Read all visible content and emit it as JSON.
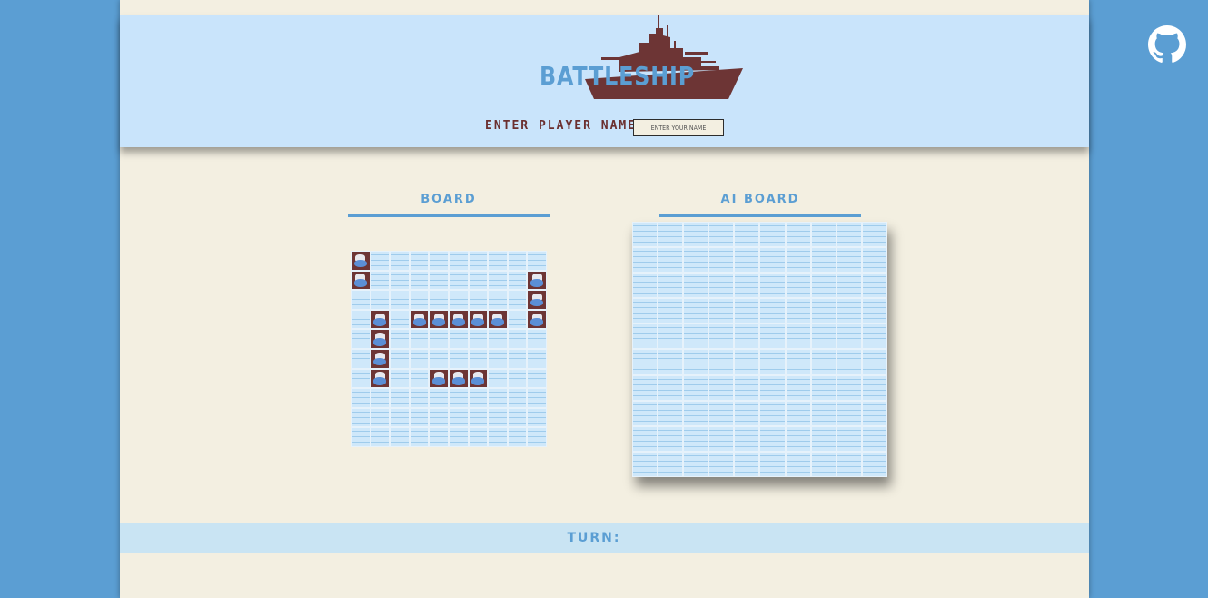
{
  "header": {
    "title": "BATTLESHIP",
    "name_label": "ENTER PLAYER NAME:",
    "name_placeholder": "ENTER YOUR NAME",
    "name_value": ""
  },
  "player_board": {
    "title": "BOARD",
    "rows": 10,
    "cols": 10,
    "ship_cells": [
      [
        0,
        0
      ],
      [
        1,
        0
      ],
      [
        1,
        9
      ],
      [
        2,
        9
      ],
      [
        3,
        9
      ],
      [
        3,
        1
      ],
      [
        4,
        1
      ],
      [
        5,
        1
      ],
      [
        6,
        1
      ],
      [
        3,
        3
      ],
      [
        3,
        4
      ],
      [
        3,
        5
      ],
      [
        3,
        6
      ],
      [
        3,
        7
      ],
      [
        6,
        4
      ],
      [
        6,
        5
      ],
      [
        6,
        6
      ]
    ]
  },
  "ai_board": {
    "title": "AI BOARD",
    "rows": 10,
    "cols": 10
  },
  "turn": {
    "label": "TURN:",
    "value": ""
  },
  "colors": {
    "background": "#5b9ed3",
    "page": "#f3efe1",
    "header": "#c9e4fb",
    "accent": "#5b9ed3",
    "ship": "#6d3535",
    "water": "#cfe8fa"
  },
  "icons": {
    "github": "github-icon",
    "logo": "battleship-silhouette-icon"
  }
}
